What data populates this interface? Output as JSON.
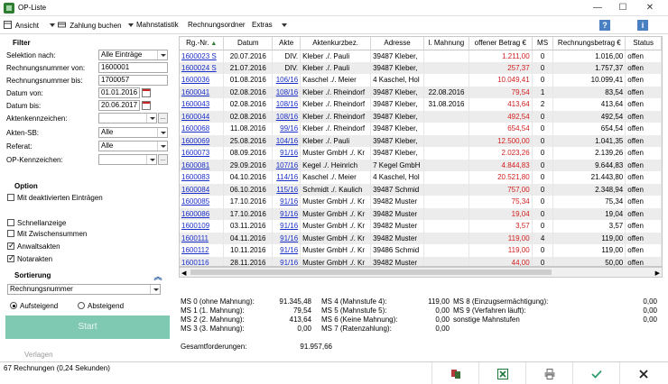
{
  "window": {
    "title": "OP-Liste"
  },
  "menu": {
    "ansicht": "Ansicht",
    "zahlung": "Zahlung buchen",
    "mahnstatistik": "Mahnstatistik",
    "rechnungsordner": "Rechnungsordner",
    "extras": "Extras",
    "help": "?",
    "info": "i"
  },
  "filter": {
    "heading": "Filter",
    "selektion_label": "Selektion nach:",
    "selektion_value": "Alle Einträge",
    "rnr_von_label": "Rechnungsnummer von:",
    "rnr_von_value": "1600001",
    "rnr_bis_label": "Rechnungsnummer bis:",
    "rnr_bis_value": "1700057",
    "datum_von_label": "Datum von:",
    "datum_von_value": "01.01.2016",
    "datum_bis_label": "Datum bis:",
    "datum_bis_value": "20.06.2017",
    "akten_kz_label": "Aktenkennzeichen:",
    "akten_kz_value": "",
    "akten_sb_label": "Akten-SB:",
    "akten_sb_value": "Alle",
    "referat_label": "Referat:",
    "referat_value": "Alle",
    "op_kz_label": "OP-Kennzeichen:",
    "op_kz_value": ""
  },
  "option": {
    "heading": "Option",
    "deaktiviert": "Mit deaktivierten Einträgen",
    "schnell": "Schnellanzeige",
    "zwischen": "Mit Zwischensummen",
    "anwalt": "Anwaltsakten",
    "notar": "Notarakten"
  },
  "sortierung": {
    "heading": "Sortierung",
    "value": "Rechnungsnummer",
    "auf": "Aufsteigend",
    "ab": "Absteigend"
  },
  "start_label": "Start",
  "verlagen": "Verlagen",
  "table": {
    "headers": [
      "Rg.-Nr.",
      "Datum",
      "Akte",
      "Aktenkurzbez.",
      "Adresse",
      "l. Mahnung",
      "offener Betrag €",
      "MS",
      "Rechnungsbetrag €",
      "Status"
    ],
    "rows": [
      [
        "1600023 S",
        "20.07.2016",
        "DIV.",
        "Kleber ./. Pauli",
        "39487 Kleber,",
        "",
        "1.211,00",
        "0",
        "1.016,00",
        "offen"
      ],
      [
        "1600024 S",
        "21.07.2016",
        "DIV.",
        "Kleber ./. Pauli",
        "39487 Kleber,",
        "",
        "257,37",
        "0",
        "1.757,37",
        "offen"
      ],
      [
        "1600036",
        "01.08.2016",
        "106/16",
        "Kaschel ./. Meier",
        "4 Kaschel, Hol",
        "",
        "10.049,41",
        "0",
        "10.099,41",
        "offen"
      ],
      [
        "1600041",
        "02.08.2016",
        "108/16",
        "Kleber ./. Rheindorf",
        "39487 Kleber,",
        "22.08.2016",
        "79,54",
        "1",
        "83,54",
        "offen"
      ],
      [
        "1600043",
        "02.08.2016",
        "108/16",
        "Kleber ./. Rheindorf",
        "39487 Kleber,",
        "31.08.2016",
        "413,64",
        "2",
        "413,64",
        "offen"
      ],
      [
        "1600044",
        "02.08.2016",
        "108/16",
        "Kleber ./. Rheindorf",
        "39487 Kleber,",
        "",
        "492,54",
        "0",
        "492,54",
        "offen"
      ],
      [
        "1600068",
        "11.08.2016",
        "99/16",
        "Kleber ./. Rheindorf",
        "39487 Kleber,",
        "",
        "654,54",
        "0",
        "654,54",
        "offen"
      ],
      [
        "1600069",
        "25.08.2016",
        "104/16",
        "Kleber ./. Pauli",
        "39487 Kleber,",
        "",
        "12.500,00",
        "0",
        "1.041,35",
        "offen"
      ],
      [
        "1600073",
        "08.09.2016",
        "91/16",
        "Muster GmbH ./. Kr",
        "39487 Kleber,",
        "",
        "2.023,26",
        "0",
        "2.139,26",
        "offen"
      ],
      [
        "1600081",
        "29.09.2016",
        "107/16",
        "Kegel ./. Heinrich",
        "7 Kegel GmbH",
        "",
        "4.844,83",
        "0",
        "9.644,83",
        "offen"
      ],
      [
        "1600083",
        "04.10.2016",
        "114/16",
        "Kaschel ./. Meier",
        "4 Kaschel, Hol",
        "",
        "20.521,80",
        "0",
        "21.443,80",
        "offen"
      ],
      [
        "1600084",
        "06.10.2016",
        "115/16",
        "Schmidt ./. Kaulich",
        "39487 Schmid",
        "",
        "757,00",
        "0",
        "2.348,94",
        "offen"
      ],
      [
        "1600085",
        "17.10.2016",
        "91/16",
        "Muster GmbH ./. Kr",
        "39482 Muster",
        "",
        "75,34",
        "0",
        "75,34",
        "offen"
      ],
      [
        "1600086",
        "17.10.2016",
        "91/16",
        "Muster GmbH ./. Kr",
        "39482 Muster",
        "",
        "19,04",
        "0",
        "19,04",
        "offen"
      ],
      [
        "1600109",
        "03.11.2016",
        "91/16",
        "Muster GmbH ./. Kr",
        "39482 Muster",
        "",
        "3,57",
        "0",
        "3,57",
        "offen"
      ],
      [
        "1600111",
        "04.11.2016",
        "91/16",
        "Muster GmbH ./. Kr",
        "39482 Muster",
        "",
        "119,00",
        "4",
        "119,00",
        "offen"
      ],
      [
        "1600112",
        "10.11.2016",
        "91/16",
        "Muster GmbH ./. Kr",
        "39486 Schmid",
        "",
        "119,00",
        "0",
        "119,00",
        "offen"
      ],
      [
        "1600116",
        "28.11.2016",
        "91/16",
        "Muster GmbH ./. Kr",
        "39482 Muster",
        "",
        "44,00",
        "0",
        "50,00",
        "offen"
      ]
    ]
  },
  "summary": {
    "col1": [
      [
        "MS 0 (ohne Mahnung):",
        "91.345,48"
      ],
      [
        "MS 1 (1. Mahnung):",
        "79,54"
      ],
      [
        "MS 2 (2. Mahnung):",
        "413,64"
      ],
      [
        "MS 3 (3. Mahnung):",
        "0,00"
      ]
    ],
    "col2": [
      [
        "MS 4 (Mahnstufe 4):",
        "119,00"
      ],
      [
        "MS 5 (Mahnstufe 5):",
        "0,00"
      ],
      [
        "MS 6 (Keine Mahnung):",
        "0,00"
      ],
      [
        "MS 7 (Ratenzahlung):",
        "0,00"
      ]
    ],
    "col3": [
      [
        "MS 8 (Einzugsermächtigung):",
        "0,00"
      ],
      [
        "MS 9 (Verfahren läuft):",
        "0,00"
      ],
      [
        "sonstige Mahnstufen",
        "0,00"
      ]
    ],
    "total_label": "Gesamtforderungen:",
    "total_value": "91.957,66"
  },
  "status": {
    "text": "67 Rechnungen (0,24 Sekunden)"
  },
  "colors": {
    "accent": "#7fc8b1",
    "link": "#1a2fc9",
    "red": "#d21f1f"
  }
}
